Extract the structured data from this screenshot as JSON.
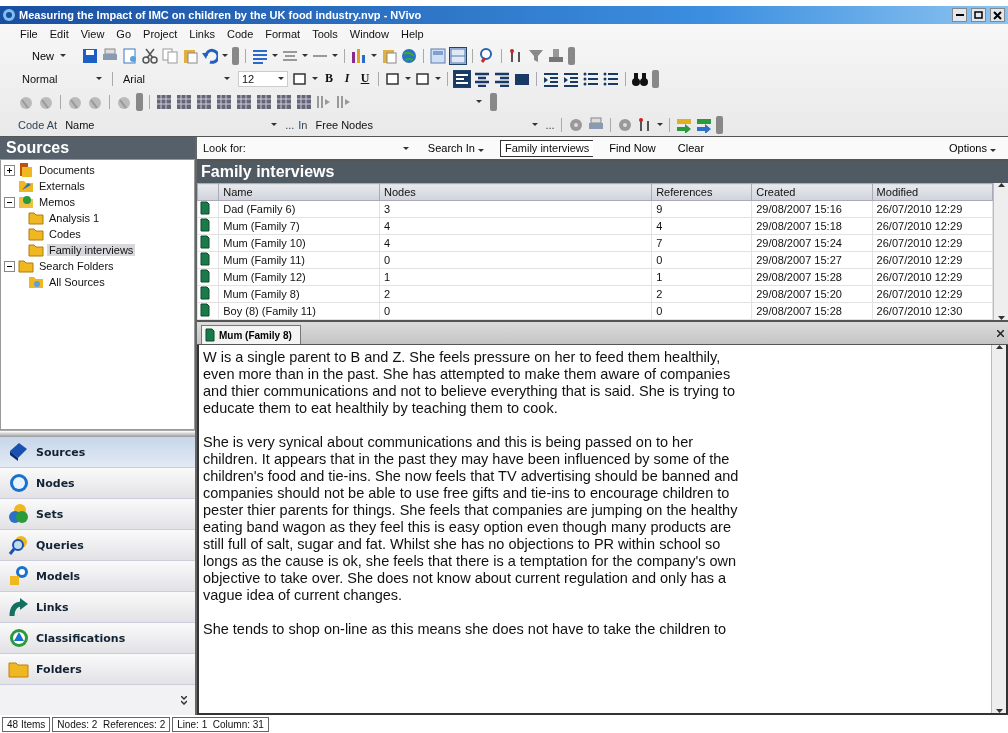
{
  "window": {
    "title": "Measuring the Impact of IMC on children by the UK food industry.nvp - NVivo"
  },
  "menu": [
    "File",
    "Edit",
    "View",
    "Go",
    "Project",
    "Links",
    "Code",
    "Format",
    "Tools",
    "Window",
    "Help"
  ],
  "toolbar": {
    "new_button": "New"
  },
  "format_bar": {
    "style": "Normal",
    "font": "Arial",
    "size": "12",
    "bold": "B",
    "italic": "I",
    "underline": "U"
  },
  "code_bar": {
    "code_at": "Code At",
    "name_field": "Name",
    "browse_1": "...",
    "in_label": "In",
    "in_field": "Free Nodes",
    "browse_2": "..."
  },
  "sidebar": {
    "title": "Sources",
    "tree": [
      {
        "label": "Documents",
        "expanded": false,
        "selected": false
      },
      {
        "label": "Externals",
        "selected": false
      },
      {
        "label": "Memos",
        "expanded": true,
        "selected": false,
        "children": [
          {
            "label": "Analysis 1",
            "selected": false
          },
          {
            "label": "Codes",
            "selected": false
          },
          {
            "label": "Family interviews",
            "selected": true
          }
        ]
      },
      {
        "label": "Search Folders",
        "expanded": true,
        "selected": false,
        "children": [
          {
            "label": "All Sources",
            "selected": false
          }
        ]
      }
    ],
    "nav": [
      {
        "label": "Sources",
        "selected": true
      },
      {
        "label": "Nodes",
        "selected": false
      },
      {
        "label": "Sets",
        "selected": false
      },
      {
        "label": "Queries",
        "selected": false
      },
      {
        "label": "Models",
        "selected": false
      },
      {
        "label": "Links",
        "selected": false
      },
      {
        "label": "Classifications",
        "selected": false
      },
      {
        "label": "Folders",
        "selected": false
      }
    ]
  },
  "find_bar": {
    "look_for": "Look for:",
    "search_in": "Search In",
    "scope": "Family interviews",
    "find_now": "Find Now",
    "clear": "Clear",
    "options": "Options"
  },
  "list": {
    "title": "Family interviews",
    "columns": [
      "Name",
      "Nodes",
      "References",
      "Created",
      "Modified"
    ],
    "rows": [
      {
        "cells": [
          "Dad (Family 6)",
          "3",
          "9",
          "29/08/2007 15:16",
          "26/07/2010 12:29"
        ],
        "selected": false
      },
      {
        "cells": [
          "Mum (Family 7)",
          "4",
          "4",
          "29/08/2007 15:18",
          "26/07/2010 12:29"
        ],
        "selected": false
      },
      {
        "cells": [
          "Mum (Family 10)",
          "4",
          "7",
          "29/08/2007 15:24",
          "26/07/2010 12:29"
        ],
        "selected": false
      },
      {
        "cells": [
          "Mum (Family 11)",
          "0",
          "0",
          "29/08/2007 15:27",
          "26/07/2010 12:29"
        ],
        "selected": false
      },
      {
        "cells": [
          "Mum (Family 12)",
          "1",
          "1",
          "29/08/2007 15:28",
          "26/07/2010 12:29"
        ],
        "selected": false
      },
      {
        "cells": [
          "Mum (Family 8)",
          "2",
          "2",
          "29/08/2007 15:20",
          "26/07/2010 12:29"
        ],
        "selected": false
      },
      {
        "cells": [
          "Boy (8) (Family 11)",
          "0",
          "0",
          "29/08/2007 15:28",
          "26/07/2010 12:30"
        ],
        "selected": false
      }
    ]
  },
  "detail": {
    "tab": "Mum (Family 8)",
    "paragraphs": [
      "W is a single parent to B and Z. She feels pressure on her to feed them healthily, even more than in the past. She has attempted to make them aware of companies and thier communications and not to believe everything that is said. She is trying to educate them to eat healthily by teaching them to cook.",
      "She is very synical about communications and this is being passed on to her children. It appears that in the past they may have been influenced by some of the children's food and tie-ins. She now feels that TV advertising should be banned and companies should not be able to use free gifts and tie-ins to encourage children to pester thier parents for things. She feels that companies are jumping on the healthy eating band wagon as they feel this is easy option even though many products are still full of salt, sugar and fat.  Whilst she has no objections to PR within school so longs as the cause is ok, she feels that there is a temptation for the company's own objective to take over. She does not know about current regulation and only has a vague idea of current changes.",
      "She tends to shop on-line as this means she does not have to take the children to"
    ]
  },
  "status_bar": [
    "48 Items",
    "Nodes: 2  References: 2",
    "Line: 1  Column: 31"
  ]
}
